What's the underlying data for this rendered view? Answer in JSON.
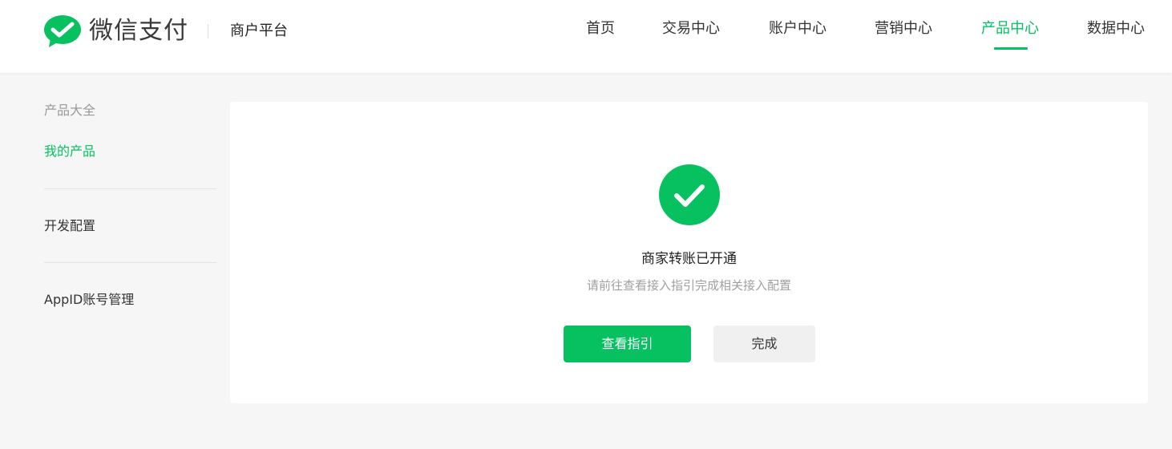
{
  "header": {
    "brand_name": "微信支付",
    "platform_name": "商户平台",
    "nav": [
      {
        "label": "首页",
        "active": false
      },
      {
        "label": "交易中心",
        "active": false
      },
      {
        "label": "账户中心",
        "active": false
      },
      {
        "label": "营销中心",
        "active": false
      },
      {
        "label": "产品中心",
        "active": true
      },
      {
        "label": "数据中心",
        "active": false
      }
    ]
  },
  "sidebar": {
    "section_title": "产品大全",
    "items": [
      {
        "label": "我的产品",
        "active": true
      },
      {
        "label": "开发配置",
        "active": false
      },
      {
        "label": "AppID账号管理",
        "active": false
      }
    ]
  },
  "result": {
    "icon": "check-circle-icon",
    "title": "商家转账已开通",
    "description": "请前往查看接入指引完成相关接入配置",
    "primary_button": "查看指引",
    "secondary_button": "完成"
  },
  "colors": {
    "brand_green": "#07c160",
    "page_bg": "#f6f6f6",
    "muted_text": "#a0a0a0",
    "secondary_button_bg": "#f0f0f0"
  }
}
